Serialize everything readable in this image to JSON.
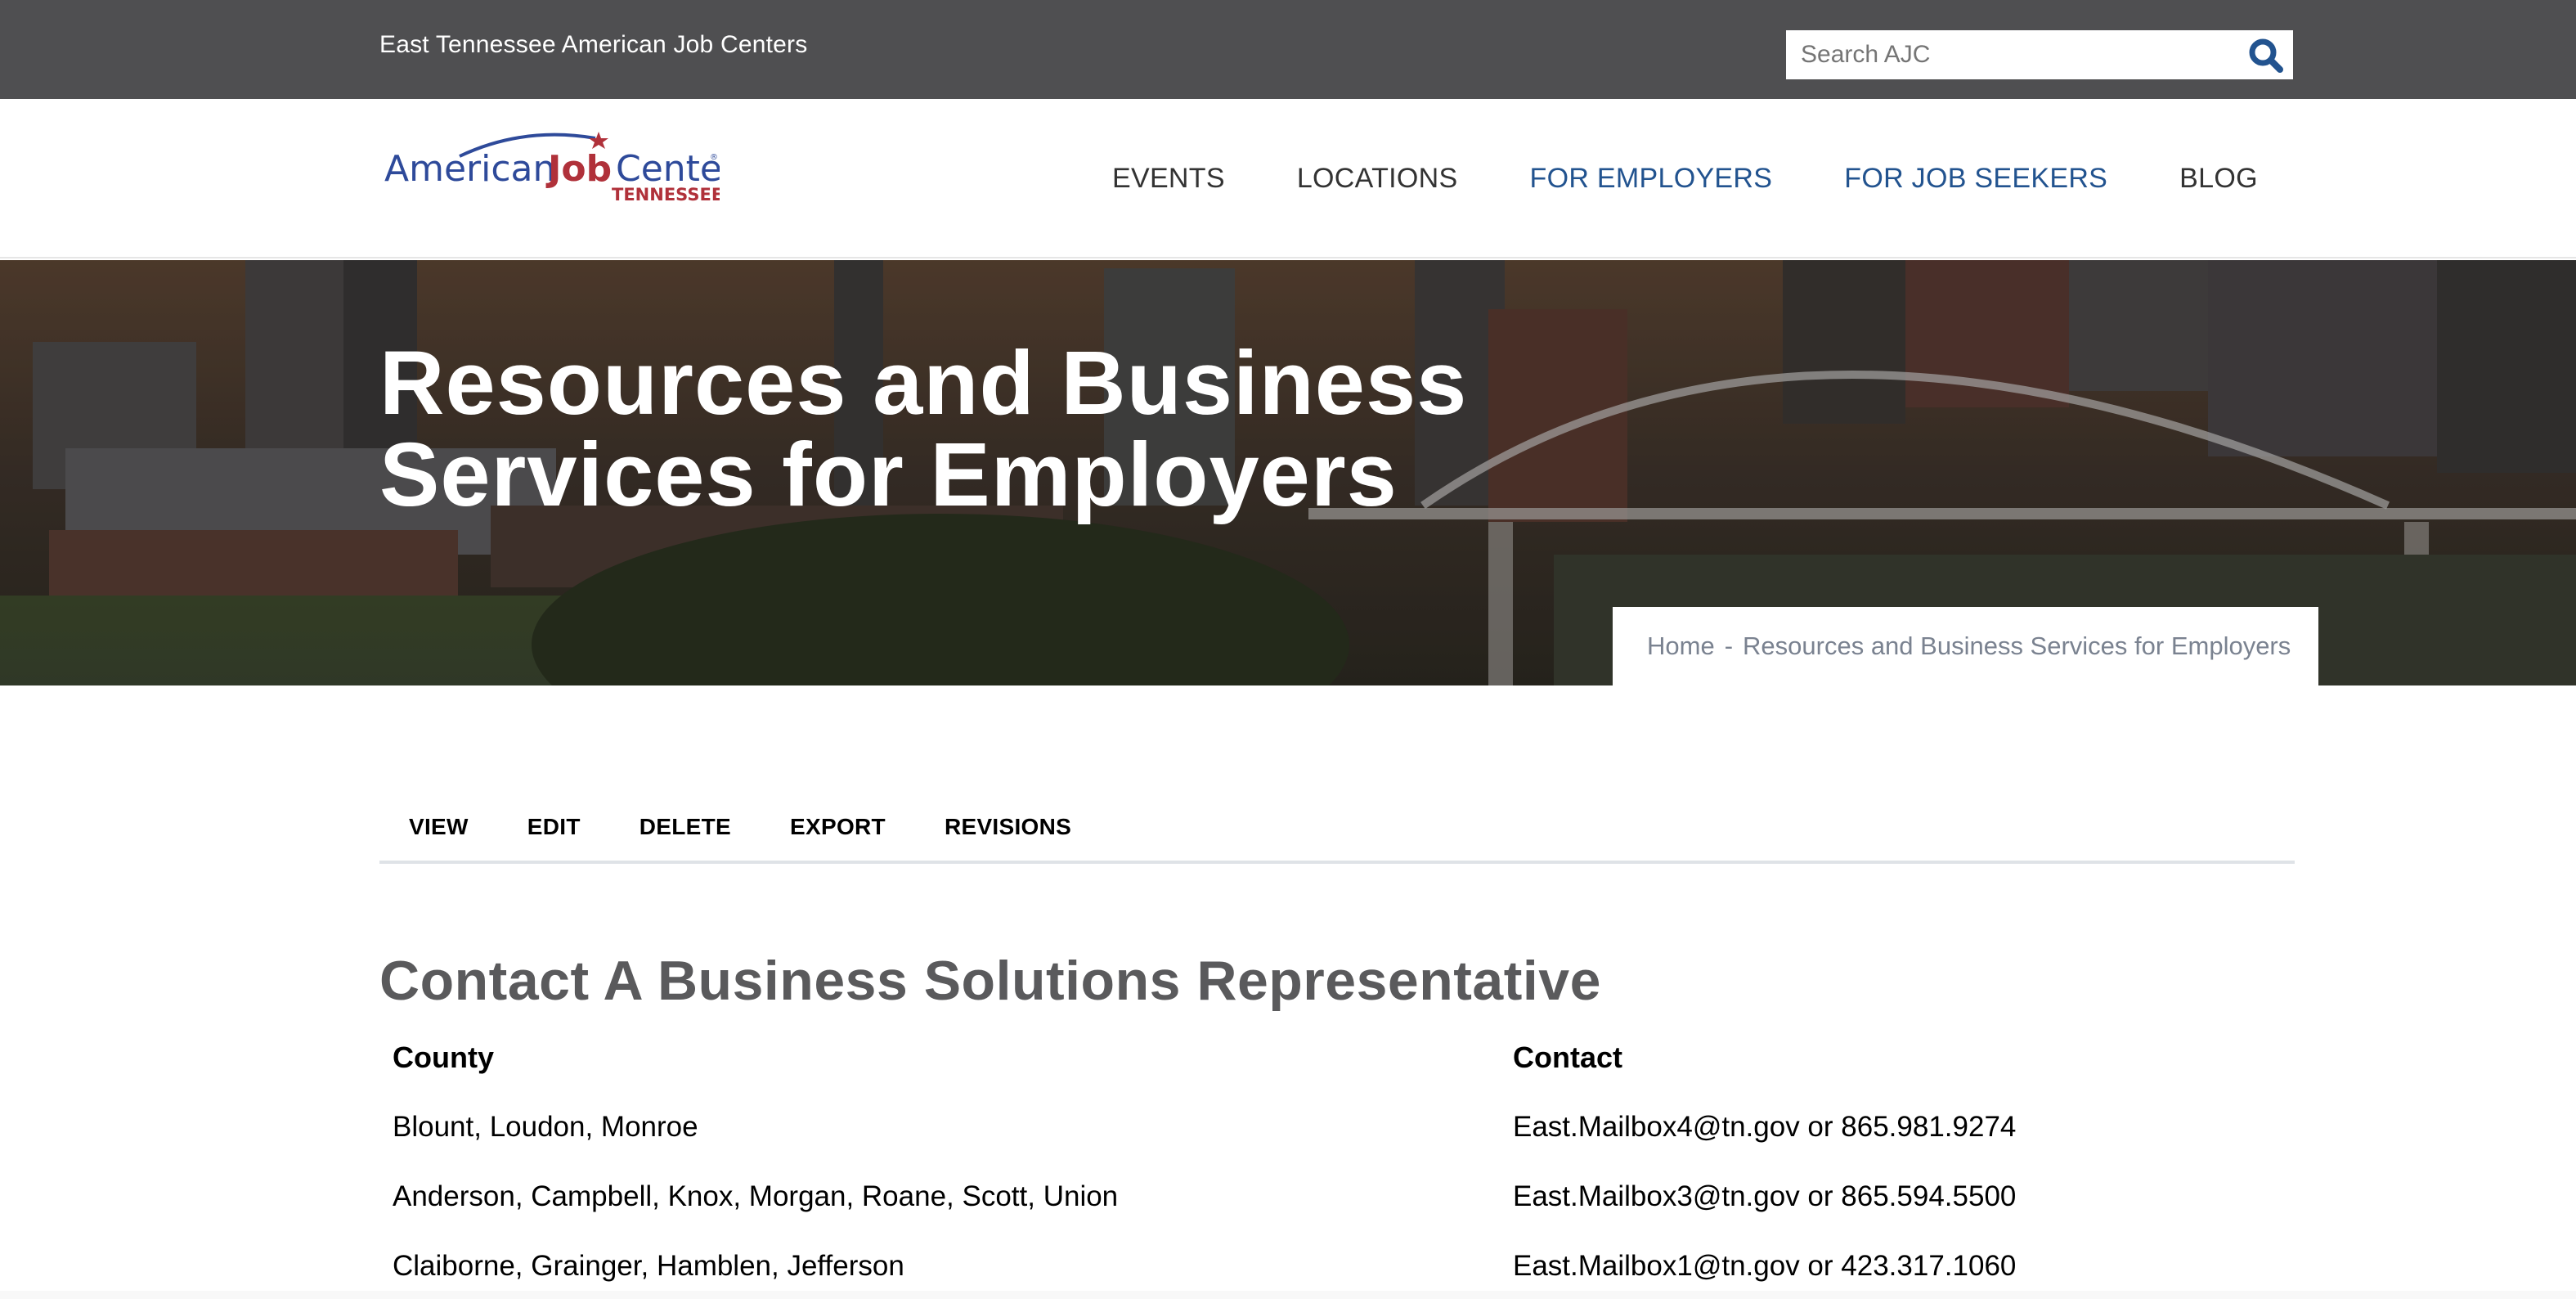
{
  "topbar": {
    "site_name": "East Tennessee American Job Centers",
    "search": {
      "placeholder": "Search AJC",
      "value": "",
      "icon": "search-icon",
      "icon_color": "#22538f"
    },
    "background": "#4f4f51"
  },
  "logo": {
    "word1": "American",
    "word2": "Job",
    "word3": "Center",
    "registered": "®",
    "subtitle": "TENNESSEE",
    "blue": "#2e4a9a",
    "red": "#b0313a"
  },
  "nav": {
    "items": [
      {
        "label": "EVENTS",
        "active": false
      },
      {
        "label": "LOCATIONS",
        "active": false
      },
      {
        "label": "FOR EMPLOYERS",
        "active": true
      },
      {
        "label": "FOR JOB SEEKERS",
        "active": true
      },
      {
        "label": "BLOG",
        "active": false
      }
    ],
    "accent_color": "#22538f"
  },
  "hero": {
    "title_line1": "Resources and Business",
    "title_line2": "Services for Employers",
    "breadcrumb": {
      "home": "Home",
      "separator": "-",
      "current": "Resources and Business Services for Employers"
    }
  },
  "tabs": [
    {
      "label": "VIEW"
    },
    {
      "label": "EDIT"
    },
    {
      "label": "DELETE"
    },
    {
      "label": "EXPORT"
    },
    {
      "label": "REVISIONS"
    }
  ],
  "content": {
    "heading": "Contact A Business Solutions Representative",
    "table": {
      "headers": [
        "County",
        "Contact"
      ],
      "rows": [
        [
          "Blount, Loudon, Monroe",
          "East.Mailbox4@tn.gov or 865.981.9274"
        ],
        [
          "Anderson, Campbell, Knox, Morgan, Roane, Scott, Union",
          "East.Mailbox3@tn.gov or 865.594.5500"
        ],
        [
          "Claiborne, Grainger, Hamblen, Jefferson",
          "East.Mailbox1@tn.gov or 423.317.1060"
        ]
      ]
    }
  }
}
